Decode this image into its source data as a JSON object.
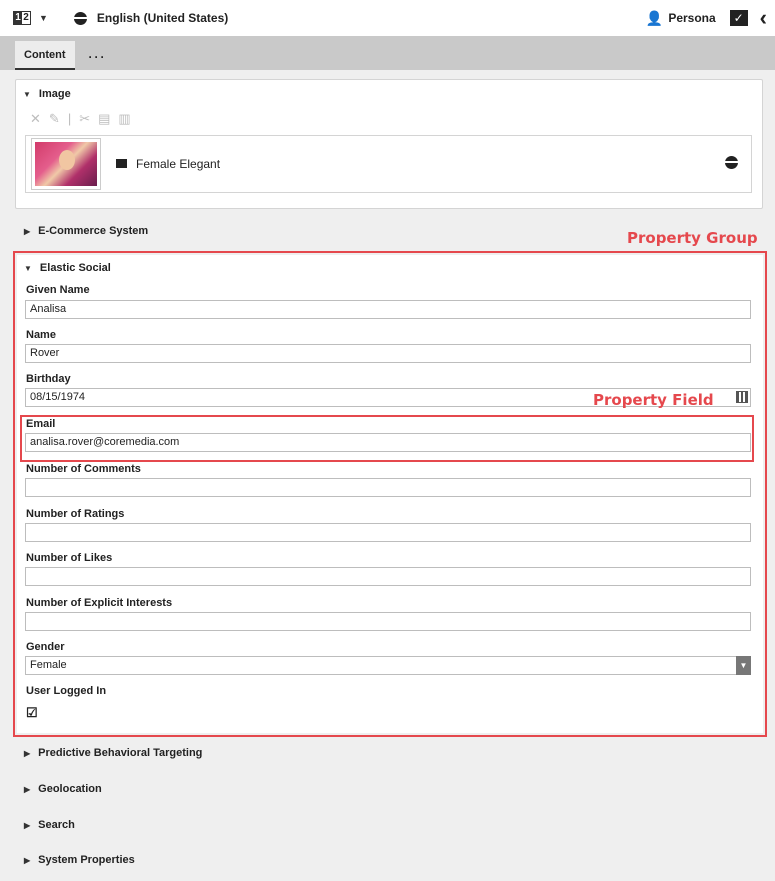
{
  "topbar": {
    "split_left": "1",
    "split_right": "2",
    "language": "English (United States)",
    "persona": "Persona"
  },
  "tabs": {
    "content": "Content",
    "more": "···"
  },
  "image_group": {
    "title": "Image",
    "toolbar_icons": [
      "close-icon",
      "pencil-icon",
      "cut-icon",
      "paste-icon",
      "copy-icon"
    ],
    "item_name": "Female Elegant"
  },
  "groups": {
    "ecommerce": "E-Commerce System",
    "elastic": "Elastic Social",
    "pbt": "Predictive Behavioral Targeting",
    "geo": "Geolocation",
    "search": "Search",
    "system": "System Properties"
  },
  "annotations": {
    "group": "Property Group",
    "field": "Property Field"
  },
  "fields": {
    "given_name": {
      "label": "Given Name",
      "value": "Analisa"
    },
    "name": {
      "label": "Name",
      "value": "Rover"
    },
    "birthday": {
      "label": "Birthday",
      "value": "08/15/1974"
    },
    "email": {
      "label": "Email",
      "value": "analisa.rover@coremedia.com"
    },
    "comments": {
      "label": "Number of Comments",
      "value": ""
    },
    "ratings": {
      "label": "Number of Ratings",
      "value": ""
    },
    "likes": {
      "label": "Number of Likes",
      "value": ""
    },
    "interests": {
      "label": "Number of Explicit Interests",
      "value": ""
    },
    "gender": {
      "label": "Gender",
      "value": "Female"
    },
    "logged_in": {
      "label": "User Logged In",
      "checked": true
    }
  }
}
